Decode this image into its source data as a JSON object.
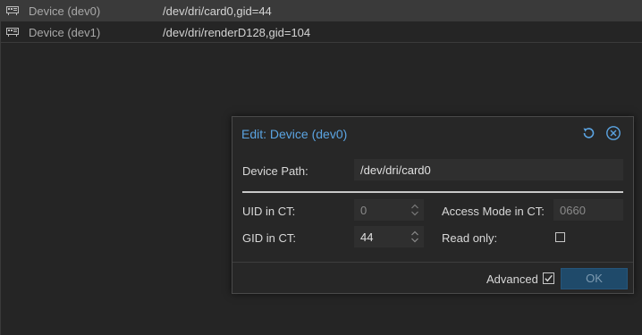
{
  "devices": [
    {
      "name": "Device (dev0)",
      "value": "/dev/dri/card0,gid=44",
      "selected": true
    },
    {
      "name": "Device (dev1)",
      "value": "/dev/dri/renderD128,gid=104",
      "selected": false
    }
  ],
  "dialog": {
    "title": "Edit: Device (dev0)",
    "device_path_label": "Device Path:",
    "device_path_value": "/dev/dri/card0",
    "uid_label": "UID in CT:",
    "uid_value": "0",
    "gid_label": "GID in CT:",
    "gid_value": "44",
    "access_mode_label": "Access Mode in CT:",
    "access_mode_value": "0660",
    "read_only_label": "Read only:",
    "read_only_checked": false,
    "advanced_label": "Advanced",
    "advanced_checked": true,
    "ok_label": "OK"
  },
  "colors": {
    "accent": "#5ba4e2",
    "background": "#252525",
    "dialog_bg": "#272727",
    "field_bg": "#2f2f2f",
    "ok_button_bg": "#1f4a6a"
  },
  "icons": {
    "row_icon": "device-card-icon",
    "reset": "reset-icon",
    "close": "close-icon",
    "spin": "spinner-arrows-icon",
    "checkbox_checked": "checkmark-icon"
  }
}
